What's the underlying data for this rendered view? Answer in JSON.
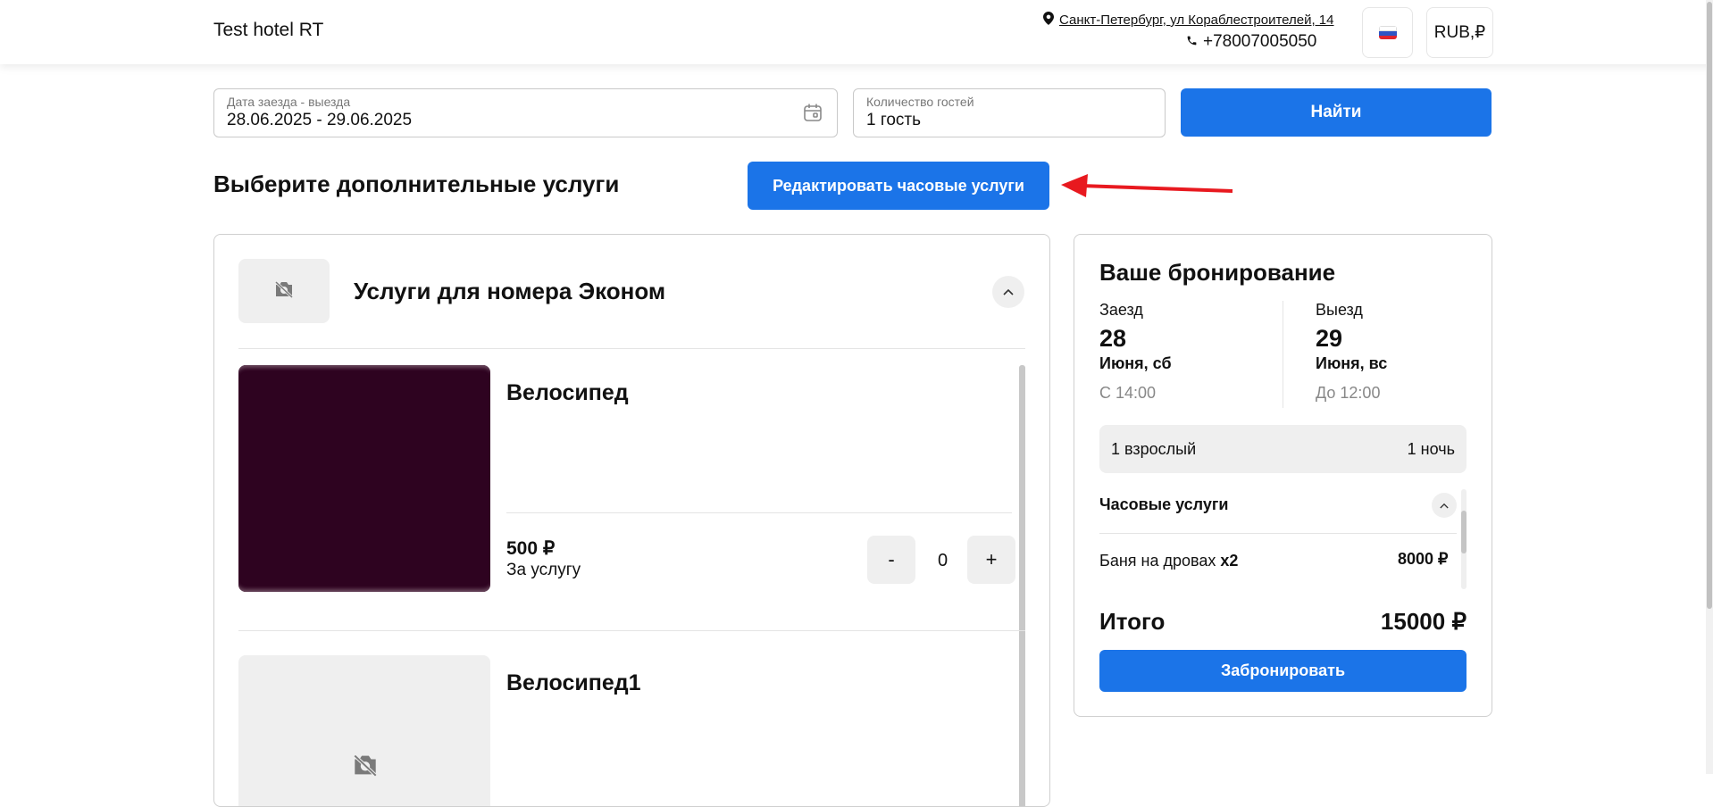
{
  "header": {
    "hotel_name": "Test hotel RT",
    "address": "Санкт-Петербург, ул Кораблестроителей, 14",
    "phone": "+78007005050",
    "currency": "RUB,₽",
    "language_flag": "ru-flag-icon"
  },
  "search": {
    "dates_label": "Дата заезда - выезда",
    "dates_value": "28.06.2025 - 29.06.2025",
    "guests_label": "Количество гостей",
    "guests_value": "1 гость",
    "find_label": "Найти"
  },
  "services": {
    "section_title": "Выберите дополнительные услуги",
    "edit_hourly_label": "Редактировать часовые услуги",
    "group_title": "Услуги для номера Эконом",
    "items": [
      {
        "name": "Велосипед",
        "price": "500 ₽",
        "unit": "За услугу",
        "qty": "0",
        "minus": "-",
        "plus": "+"
      },
      {
        "name": "Велосипед1"
      }
    ]
  },
  "booking": {
    "title": "Ваше бронирование",
    "checkin": {
      "label": "Заезд",
      "day": "28",
      "month_weekday": "Июня, сб",
      "time": "С 14:00"
    },
    "checkout": {
      "label": "Выезд",
      "day": "29",
      "month_weekday": "Июня, вс",
      "time": "До 12:00"
    },
    "guests": "1 взрослый",
    "nights": "1 ночь",
    "hourly_title": "Часовые услуги",
    "hourly_items": [
      {
        "name": "Баня на дровах",
        "multiplier": "x2",
        "price": "8000 ₽"
      }
    ],
    "total_label": "Итого",
    "total_value": "15000 ₽",
    "book_label": "Забронировать"
  },
  "colors": {
    "accent": "#1b74e8",
    "arrow": "#e8191f",
    "service_image": "#2e0320"
  }
}
